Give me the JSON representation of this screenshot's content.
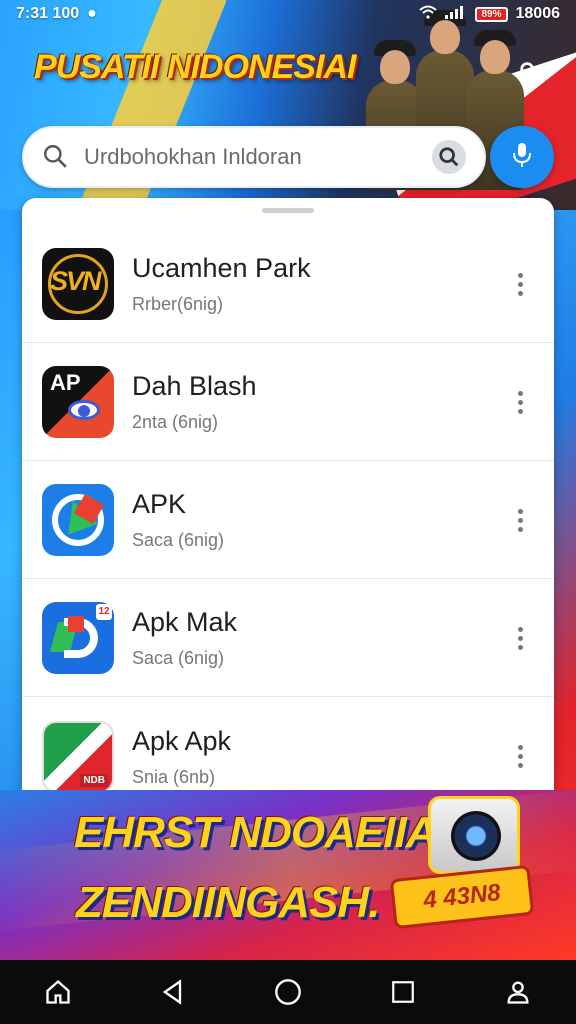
{
  "status_bar": {
    "left_text": "7:31 100",
    "right_text": "18006",
    "battery_label": "89%"
  },
  "top_banner": {
    "title": "PUSATII NIDONESIAI"
  },
  "search": {
    "placeholder": "Urdbohokhan Inldoran"
  },
  "apps": [
    {
      "title": "Ucamhen Park",
      "subtitle": "Rrber(6nig)",
      "icon_text": "SVN"
    },
    {
      "title": "Dah Blash",
      "subtitle": "2nta (6nig)",
      "icon_text": "AP"
    },
    {
      "title": "APK",
      "subtitle": "Saca (6nig)",
      "icon_text": ""
    },
    {
      "title": "Apk Mak",
      "subtitle": "Saca (6nig)",
      "icon_text": "12"
    },
    {
      "title": "Apk Apk",
      "subtitle": "Snia (6nb)",
      "icon_text": "NDB"
    }
  ],
  "bottom_banner": {
    "line1": "EHRST NDOAEIIA",
    "line2": "ZENDIINGASH.",
    "price": "4 43N8"
  },
  "colors": {
    "accent": "#1b8cf0",
    "banner_yellow": "#ffd21c",
    "banner_red": "#e3222a"
  }
}
